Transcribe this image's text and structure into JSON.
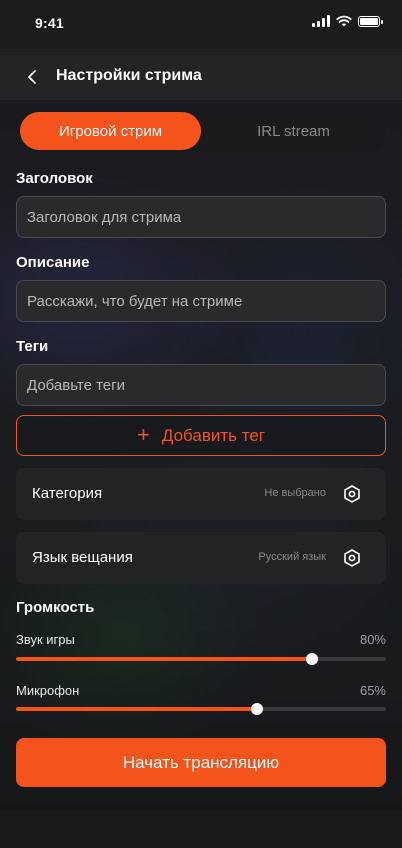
{
  "status_bar": {
    "time": "9:41",
    "icons": [
      "signal-icon",
      "wifi-icon",
      "battery-icon"
    ]
  },
  "header": {
    "back_icon": "chevron-left-icon",
    "title": "Настройки стрима"
  },
  "tabs": [
    {
      "label": "Игровой стрим",
      "active": true
    },
    {
      "label": "IRL stream",
      "active": false
    }
  ],
  "fields": {
    "title": {
      "label": "Заголовок",
      "placeholder": "Заголовок для стрима",
      "value": ""
    },
    "description": {
      "label": "Описание",
      "placeholder": "Расскажи, что будет на стриме",
      "value": ""
    },
    "tags": {
      "label": "Теги",
      "placeholder": "Добавьте теги",
      "value": ""
    }
  },
  "add_tag": {
    "icon": "plus-icon",
    "label": "Добавить тег"
  },
  "category": {
    "label": "Категория",
    "value": "Не выбрано",
    "icon": "hexagon-settings-icon"
  },
  "language": {
    "label": "Язык вещания",
    "value": "Русский язык",
    "icon": "hexagon-settings-icon"
  },
  "volume": {
    "title": "Громкость",
    "game": {
      "label": "Звук игры",
      "value_text": "80%",
      "level": 0.8
    },
    "mic": {
      "label": "Микрофон",
      "value_text": "65%",
      "level": 0.65
    }
  },
  "cta": {
    "label": "Начать трансляцию"
  },
  "colors": {
    "accent": "#f4541c",
    "background": "#141416",
    "surface": "#232325"
  }
}
